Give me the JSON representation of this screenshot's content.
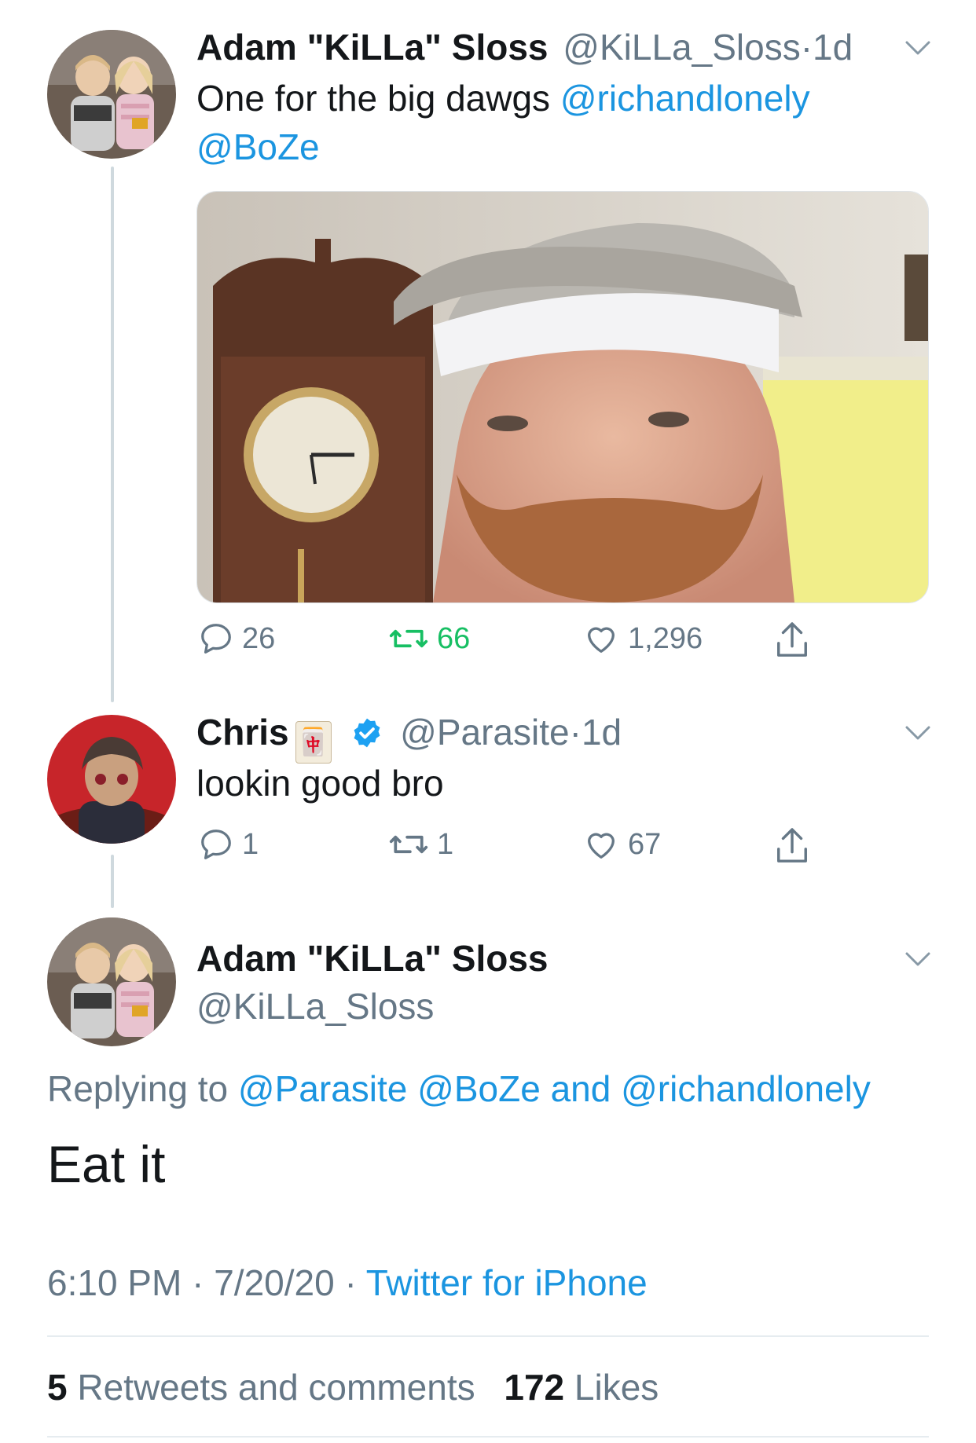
{
  "tweet1": {
    "name": "Adam \"KiLLa\" Sloss",
    "handle": "@KiLLa_Sloss",
    "sep": "·",
    "time": "1d",
    "text_plain": "One for the big dawgs ",
    "mention1": "@richandlonely",
    "mention2": "@BoZe",
    "actions": {
      "replies": "26",
      "retweets": "66",
      "likes": "1,296"
    }
  },
  "tweet2": {
    "name": "Chris",
    "emoji": "🀄",
    "handle": "@Parasite",
    "sep": "·",
    "time": "1d",
    "text": "lookin good bro",
    "actions": {
      "replies": "1",
      "retweets": "1",
      "likes": "67"
    }
  },
  "main": {
    "name": "Adam \"KiLLa\" Sloss",
    "handle": "@KiLLa_Sloss",
    "replying_prefix": "Replying to ",
    "reply_mentions": "@Parasite @BoZe and @richandlonely",
    "text": "Eat it",
    "time": "6:10 PM",
    "sep1": " · ",
    "date": "7/20/20",
    "sep2": " · ",
    "source": "Twitter for iPhone",
    "retweets_count": "5",
    "retweets_label": " Retweets and comments",
    "likes_count": "172",
    "likes_label": " Likes"
  },
  "colors": {
    "link": "#1b95e0",
    "retweet_green": "#17bf63",
    "muted": "#657786",
    "verified": "#1da1f2"
  },
  "icons": [
    "reply-icon",
    "retweet-icon",
    "like-icon",
    "share-icon",
    "chevron-down-icon",
    "verified-badge-icon"
  ]
}
